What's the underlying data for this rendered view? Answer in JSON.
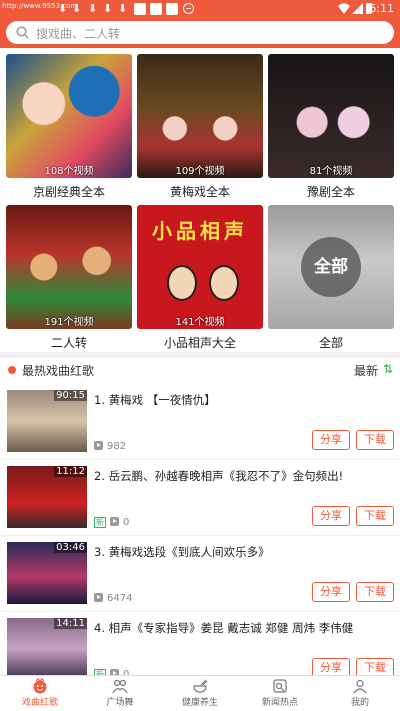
{
  "status": {
    "watermark": "http://www.9553.com",
    "time": "6:11"
  },
  "search": {
    "placeholder": "搜戏曲、二人转"
  },
  "categories": [
    {
      "label": "京剧经典全本",
      "count": "108个视频"
    },
    {
      "label": "黄梅戏全本",
      "count": "109个视频"
    },
    {
      "label": "豫剧全本",
      "count": "81个视频"
    },
    {
      "label": "二人转",
      "count": "191个视频"
    },
    {
      "label": "小品相声大全",
      "count": "141个视频",
      "banner": "小品相声"
    },
    {
      "label": "全部",
      "count": "",
      "button": "全部"
    }
  ],
  "section": {
    "title": "最热戏曲红歌",
    "sort": "最新"
  },
  "videos": [
    {
      "title": "1. 黄梅戏 【一夜情仇】",
      "duration": "90:15",
      "plays": "982",
      "is_new": false
    },
    {
      "title": "2. 岳云鹏、孙越春晚相声《我忍不了》金句频出!",
      "duration": "11:12",
      "plays": "0",
      "is_new": true
    },
    {
      "title": "3. 黄梅戏选段《到底人间欢乐多》",
      "duration": "03:46",
      "plays": "6474",
      "is_new": false
    },
    {
      "title": "4. 相声《专家指导》姜昆 戴志诚 郑健 周炜 李伟健",
      "duration": "14:11",
      "plays": "0",
      "is_new": true
    }
  ],
  "actions": {
    "share": "分享",
    "download": "下载",
    "new_badge": "新"
  },
  "tabs": [
    {
      "label": "戏曲红歌",
      "icon": "opera-icon",
      "active": true
    },
    {
      "label": "广场舞",
      "icon": "dance-icon",
      "active": false
    },
    {
      "label": "健康养生",
      "icon": "health-bowl-icon",
      "active": false
    },
    {
      "label": "新闻热点",
      "icon": "news-icon",
      "active": false
    },
    {
      "label": "我的",
      "icon": "profile-icon",
      "active": false
    }
  ],
  "colors": {
    "accent": "#ef5a3c",
    "new_badge": "#3bb36a"
  }
}
